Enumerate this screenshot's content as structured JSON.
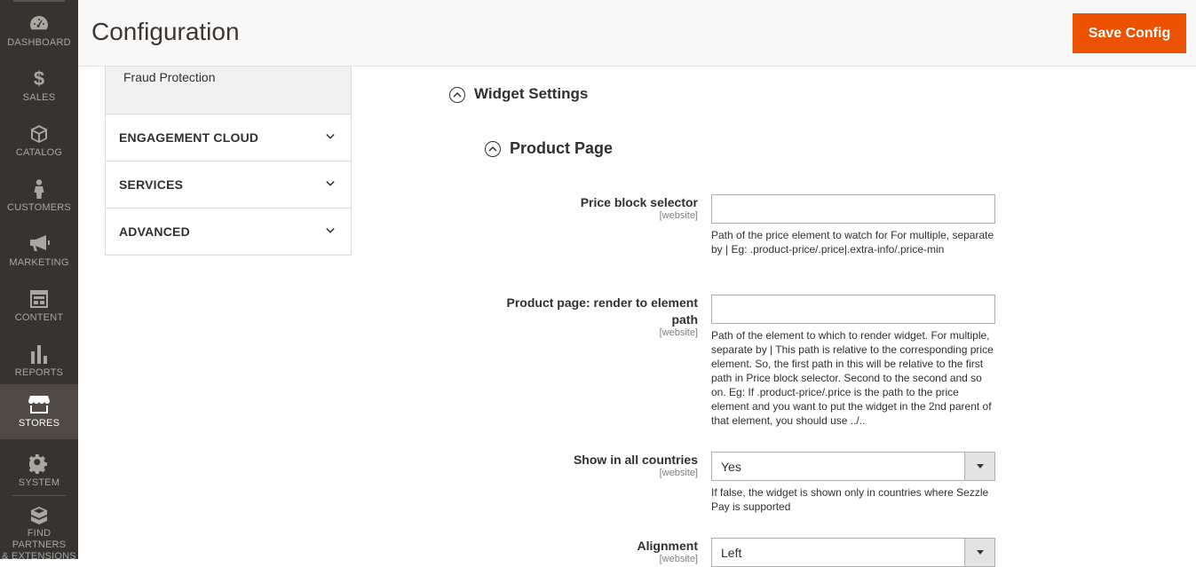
{
  "nav": {
    "items": [
      {
        "label": "DASHBOARD",
        "icon": "dashboard-icon"
      },
      {
        "label": "SALES",
        "icon": "dollar-icon"
      },
      {
        "label": "CATALOG",
        "icon": "box-icon"
      },
      {
        "label": "CUSTOMERS",
        "icon": "person-icon"
      },
      {
        "label": "MARKETING",
        "icon": "megaphone-icon"
      },
      {
        "label": "CONTENT",
        "icon": "layout-icon"
      },
      {
        "label": "REPORTS",
        "icon": "bar-chart-icon"
      },
      {
        "label": "STORES",
        "icon": "storefront-icon"
      },
      {
        "label": "SYSTEM",
        "icon": "gear-icon"
      },
      {
        "label": "FIND PARTNERS & EXTENSIONS",
        "label_line1": "FIND PARTNERS",
        "label_line2": "& EXTENSIONS",
        "icon": "cubes-icon"
      }
    ],
    "active": "STORES"
  },
  "header": {
    "title": "Configuration",
    "save_label": "Save Config"
  },
  "tabs": {
    "sub_item": "Fraud Protection",
    "groups": [
      "ENGAGEMENT CLOUD",
      "SERVICES",
      "ADVANCED"
    ]
  },
  "main": {
    "section_title": "Widget Settings",
    "subsection_title": "Product Page",
    "fields": [
      {
        "label": "Price block selector",
        "scope": "[website]",
        "value": "",
        "note": "Path of the price element to watch for For multiple, separate by | Eg: .product-price/.price|.extra-info/.price-min"
      },
      {
        "label": "Product page: render to element path",
        "label_line1": "Product page: render to element",
        "label_line2": "path",
        "scope": "[website]",
        "value": "",
        "note": "Path of the element to which to render widget. For multiple, separate by | This path is relative to the corresponding price element. So, the first path in this will be relative to the first path in Price block selector. Second to the second and so on. Eg: If .product-price/.price is the path to the price element and you want to put the widget in the 2nd parent of that element, you should use ../.."
      },
      {
        "label": "Show in all countries",
        "scope": "[website]",
        "value": "Yes",
        "note": "If false, the widget is shown only in countries where Sezzle Pay is supported"
      },
      {
        "label": "Alignment",
        "scope": "[website]",
        "value": "Left"
      }
    ]
  },
  "colors": {
    "sidebar_bg": "#373330",
    "active_bg": "#514943",
    "accent": "#eb5202"
  }
}
